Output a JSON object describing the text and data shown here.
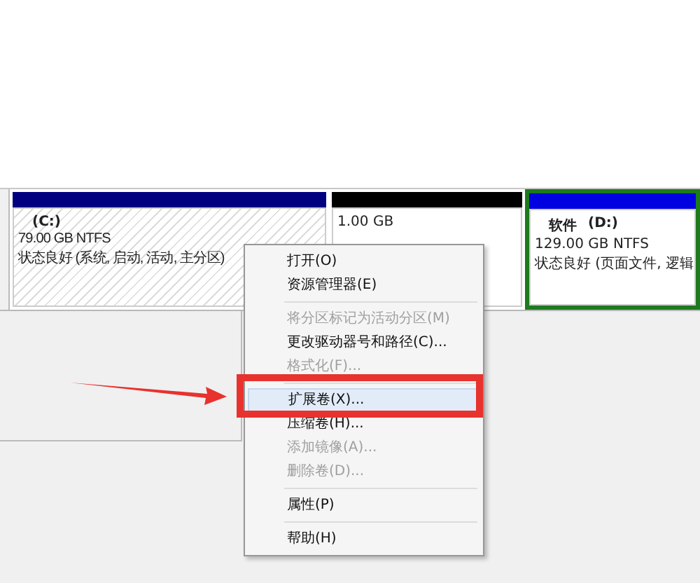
{
  "partitions": [
    {
      "kind": "primary",
      "name": "(C:)",
      "size": "79.00 GB NTFS",
      "status": "状态良好 (系统, 启动, 活动, 主分区)",
      "selected": false
    },
    {
      "kind": "unallocated",
      "size": "1.00 GB",
      "selected": false
    },
    {
      "kind": "logical",
      "name": "(D:)",
      "label": "软件",
      "size": "129.00 GB NTFS",
      "status": "状态良好 (页面文件, 逻辑",
      "selected": true
    }
  ],
  "context_menu": {
    "items": [
      {
        "kind": "item",
        "label": "打开(O)",
        "disabled": false,
        "selected": false
      },
      {
        "kind": "item",
        "label": "资源管理器(E)",
        "disabled": false,
        "selected": false
      },
      {
        "kind": "separator"
      },
      {
        "kind": "item",
        "label": "将分区标记为活动分区(M)",
        "disabled": true,
        "selected": false
      },
      {
        "kind": "item",
        "label": "更改驱动器号和路径(C)...",
        "disabled": false,
        "selected": false
      },
      {
        "kind": "item",
        "label": "格式化(F)...",
        "disabled": true,
        "selected": false
      },
      {
        "kind": "separator"
      },
      {
        "kind": "item",
        "label": "扩展卷(X)...",
        "disabled": false,
        "selected": true
      },
      {
        "kind": "item",
        "label": "压缩卷(H)...",
        "disabled": false,
        "selected": false
      },
      {
        "kind": "item",
        "label": "添加镜像(A)...",
        "disabled": true,
        "selected": false
      },
      {
        "kind": "item",
        "label": "删除卷(D)...",
        "disabled": true,
        "selected": false
      },
      {
        "kind": "separator"
      },
      {
        "kind": "item",
        "label": "属性(P)",
        "disabled": false,
        "selected": false
      },
      {
        "kind": "separator"
      },
      {
        "kind": "item",
        "label": "帮助(H)",
        "disabled": false,
        "selected": false
      }
    ]
  }
}
